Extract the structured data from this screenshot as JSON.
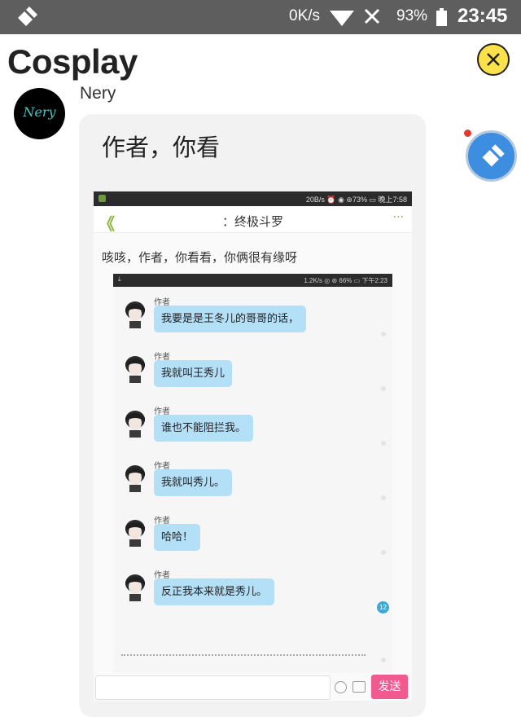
{
  "status_bar": {
    "network_speed": "0K/s",
    "battery_percent": "93%",
    "time": "23:45",
    "icons": [
      "cleaner-app-icon",
      "wifi-icon",
      "no-signal-icon",
      "battery-icon"
    ]
  },
  "header": {
    "title": "Cosplay",
    "close_icon": "close-icon",
    "colors": {
      "close_button_bg": "#fbe24a"
    }
  },
  "message": {
    "avatar_text": "Nery",
    "sender_name": "Nery",
    "text": "作者，你看",
    "bubble_color": "#f2f2f2"
  },
  "floating_button": {
    "icon": "broom-icon",
    "color": "#3d8ee0"
  },
  "screenshot": {
    "status": {
      "info": "20B/s ⏰ ◉ ⊛73% ▭ 晚上7:58"
    },
    "nav": {
      "back_icon": "back-chevron-icon",
      "title": "：终极斗罗",
      "more": "···"
    },
    "first_message": "咳咳，作者，你看看，你俩很有缘呀",
    "inner": {
      "status": {
        "download_icon": "⤓",
        "info": "1.2K/s ◎ ⊛ 66% ▭ 下午2:23"
      },
      "messages": [
        {
          "author": "作者",
          "text": "我要是是王冬儿的哥哥的话，"
        },
        {
          "author": "作者",
          "text": "我就叫王秀儿"
        },
        {
          "author": "作者",
          "text": "谁也不能阻拦我。"
        },
        {
          "author": "作者",
          "text": "我就叫秀儿。"
        },
        {
          "author": "作者",
          "text": "哈哈！"
        },
        {
          "author": "作者",
          "text": "反正我本来就是秀儿。"
        }
      ],
      "unread_badge": "12",
      "bubble_color": "#b3dff7"
    },
    "input": {
      "value": "",
      "send_label": "发送",
      "send_color": "#f05a8f"
    }
  }
}
